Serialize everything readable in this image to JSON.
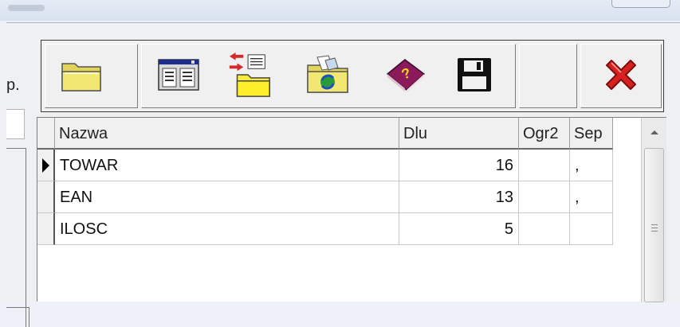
{
  "left_panel": {
    "fragment_text": "p."
  },
  "toolbar": {
    "buttons": [
      {
        "name": "open",
        "icon": "open-folder-icon"
      },
      {
        "name": "view",
        "icon": "form-view-icon"
      },
      {
        "name": "import-export",
        "icon": "import-export-icon"
      },
      {
        "name": "refresh",
        "icon": "refresh-folder-icon"
      },
      {
        "name": "help",
        "icon": "help-book-icon"
      },
      {
        "name": "save",
        "icon": "save-disk-icon"
      },
      {
        "name": "close",
        "icon": "close-x-icon"
      }
    ]
  },
  "grid": {
    "columns": [
      "Nazwa",
      "Dlu",
      "Ogr2",
      "Sep"
    ],
    "rows": [
      {
        "nazwa": "TOWAR",
        "dlu": "16",
        "ogr2": "",
        "sep": ",",
        "current": true
      },
      {
        "nazwa": "EAN",
        "dlu": "13",
        "ogr2": "",
        "sep": ",",
        "current": false
      },
      {
        "nazwa": "ILOSC",
        "dlu": "5",
        "ogr2": "",
        "sep": "",
        "current": false
      }
    ]
  },
  "colors": {
    "close_red": "#d92020",
    "folder_yellow": "#f3e774"
  }
}
